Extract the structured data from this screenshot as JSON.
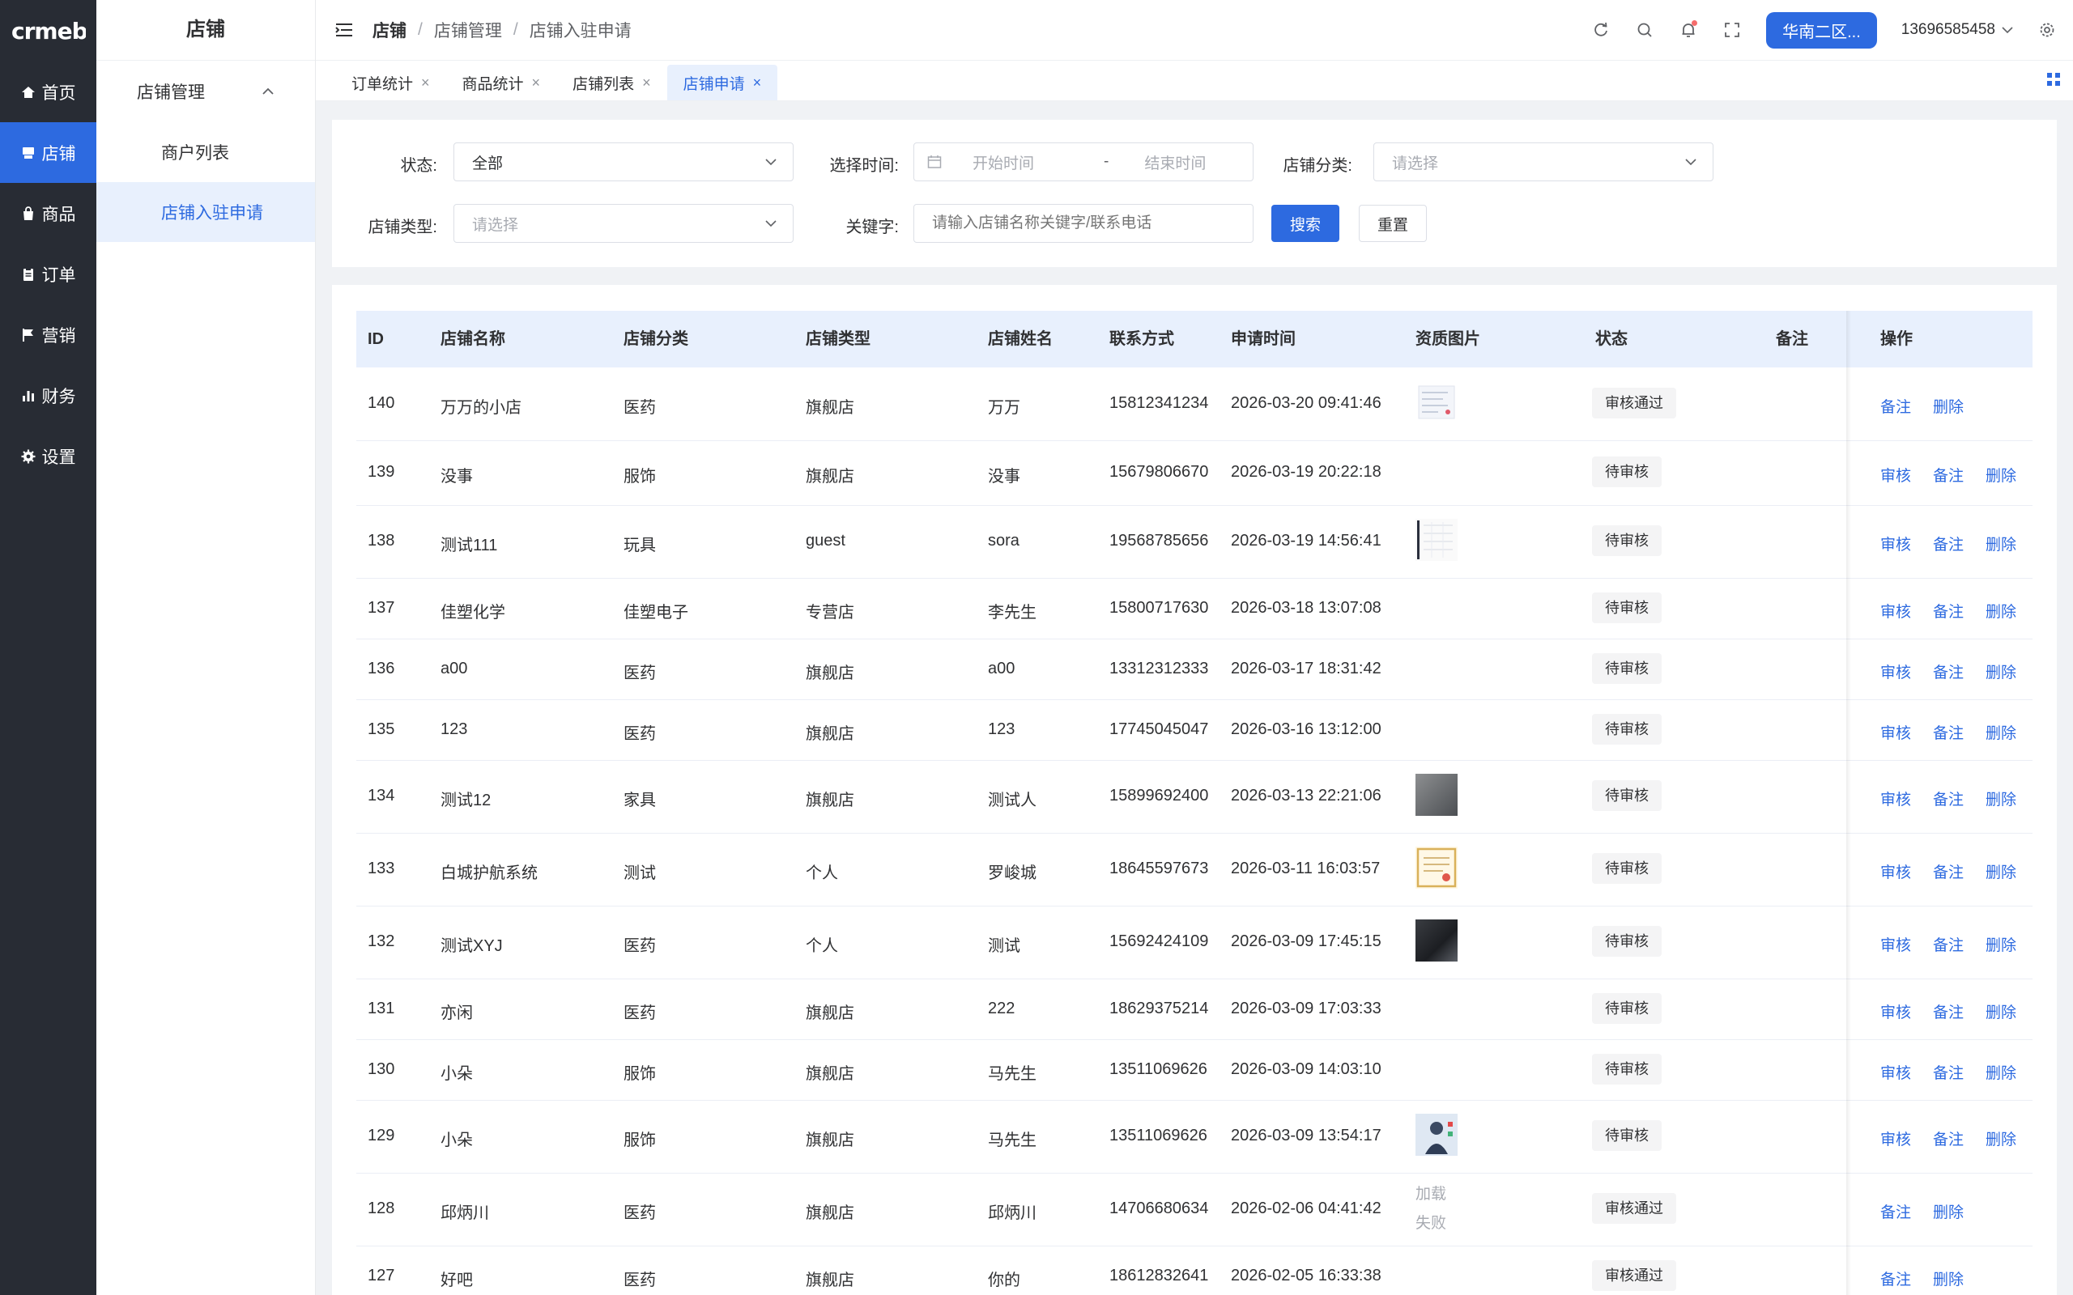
{
  "app": {
    "logo_text": "crmeb"
  },
  "rail": [
    {
      "label": "首页",
      "icon": "home-icon",
      "active": false
    },
    {
      "label": "店铺",
      "icon": "store-icon",
      "active": true
    },
    {
      "label": "商品",
      "icon": "bag-icon",
      "active": false
    },
    {
      "label": "订单",
      "icon": "clipboard-icon",
      "active": false
    },
    {
      "label": "营销",
      "icon": "flag-icon",
      "active": false
    },
    {
      "label": "财务",
      "icon": "bar-chart-icon",
      "active": false
    },
    {
      "label": "设置",
      "icon": "gear-icon",
      "active": false
    }
  ],
  "submenu": {
    "title": "店铺",
    "group": "店铺管理",
    "items": [
      "商户列表",
      "店铺入驻申请"
    ]
  },
  "header": {
    "breadcrumb": [
      "店铺",
      "店铺管理",
      "店铺入驻申请"
    ],
    "region": "华南二区...",
    "user": "13696585458"
  },
  "tabs": [
    {
      "label": "订单统计",
      "active": false
    },
    {
      "label": "商品统计",
      "active": false
    },
    {
      "label": "店铺列表",
      "active": false
    },
    {
      "label": "店铺申请",
      "active": true
    }
  ],
  "filters": {
    "status_label": "状态:",
    "status_value": "全部",
    "time_label": "选择时间:",
    "time_start_placeholder": "开始时间",
    "time_sep": "-",
    "time_end_placeholder": "结束时间",
    "category_label": "店铺分类:",
    "category_placeholder": "请选择",
    "type_label": "店铺类型:",
    "type_placeholder": "请选择",
    "keyword_label": "关键字:",
    "keyword_placeholder": "请输入店铺名称关键字/联系电话",
    "search_button": "搜索",
    "reset_button": "重置"
  },
  "table": {
    "columns": [
      "ID",
      "店铺名称",
      "店铺分类",
      "店铺类型",
      "店铺姓名",
      "联系方式",
      "申请时间",
      "资质图片",
      "状态",
      "备注",
      "操作"
    ],
    "actions": {
      "review": "审核",
      "remark": "备注",
      "delete": "删除"
    },
    "img_failed_text": "加载失败",
    "rows": [
      {
        "id": "140",
        "name": "万万的小店",
        "category": "医药",
        "type": "旗舰店",
        "owner": "万万",
        "phone": "15812341234",
        "time": "2026-03-20 09:41:46",
        "image": "document-thumb",
        "status": "审核通过"
      },
      {
        "id": "139",
        "name": "没事",
        "category": "服饰",
        "type": "旗舰店",
        "owner": "没事",
        "phone": "15679806670",
        "time": "2026-03-19 20:22:18",
        "image": "",
        "status": "待审核"
      },
      {
        "id": "138",
        "name": "测试111",
        "category": "玩具",
        "type": "guest",
        "owner": "sora",
        "phone": "19568785656",
        "time": "2026-03-19 14:56:41",
        "image": "screen-thumb",
        "status": "待审核"
      },
      {
        "id": "137",
        "name": "佳塑化学",
        "category": "佳塑电子",
        "type": "专营店",
        "owner": "李先生",
        "phone": "15800717630",
        "time": "2026-03-18 13:07:08",
        "image": "",
        "status": "待审核"
      },
      {
        "id": "136",
        "name": "a00",
        "category": "医药",
        "type": "旗舰店",
        "owner": "a00",
        "phone": "13312312333",
        "time": "2026-03-17 18:31:42",
        "image": "",
        "status": "待审核"
      },
      {
        "id": "135",
        "name": "123",
        "category": "医药",
        "type": "旗舰店",
        "owner": "123",
        "phone": "17745045047",
        "time": "2026-03-16 13:12:00",
        "image": "",
        "status": "待审核"
      },
      {
        "id": "134",
        "name": "测试12",
        "category": "家具",
        "type": "旗舰店",
        "owner": "测试人",
        "phone": "15899692400",
        "time": "2026-03-13 22:21:06",
        "image": "photo-gray-thumb",
        "status": "待审核"
      },
      {
        "id": "133",
        "name": "白城护航系统",
        "category": "测试",
        "type": "个人",
        "owner": "罗峻城",
        "phone": "18645597673",
        "time": "2026-03-11 16:03:57",
        "image": "certificate-thumb",
        "status": "待审核"
      },
      {
        "id": "132",
        "name": "测试XYJ",
        "category": "医药",
        "type": "个人",
        "owner": "测试",
        "phone": "15692424109",
        "time": "2026-03-09 17:45:15",
        "image": "photo-dark-thumb",
        "status": "待审核"
      },
      {
        "id": "131",
        "name": "亦闲",
        "category": "医药",
        "type": "旗舰店",
        "owner": "222",
        "phone": "18629375214",
        "time": "2026-03-09 17:03:33",
        "image": "",
        "status": "待审核"
      },
      {
        "id": "130",
        "name": "小朵",
        "category": "服饰",
        "type": "旗舰店",
        "owner": "马先生",
        "phone": "13511069626",
        "time": "2026-03-09 14:03:10",
        "image": "",
        "status": "待审核"
      },
      {
        "id": "129",
        "name": "小朵",
        "category": "服饰",
        "type": "旗舰店",
        "owner": "马先生",
        "phone": "13511069626",
        "time": "2026-03-09 13:54:17",
        "image": "person-thumb",
        "status": "待审核"
      },
      {
        "id": "128",
        "name": "邱炳川",
        "category": "医药",
        "type": "旗舰店",
        "owner": "邱炳川",
        "phone": "14706680634",
        "time": "2026-02-06 04:41:42",
        "image": "failed",
        "status": "审核通过"
      },
      {
        "id": "127",
        "name": "好吧",
        "category": "医药",
        "type": "旗舰店",
        "owner": "你的",
        "phone": "18612832641",
        "time": "2026-02-05 16:33:38",
        "image": "",
        "status": "审核通过"
      }
    ]
  },
  "colors": {
    "primary": "#2d6ae0",
    "rail_bg": "#282c34",
    "header_row_bg": "#e8f0fd"
  }
}
